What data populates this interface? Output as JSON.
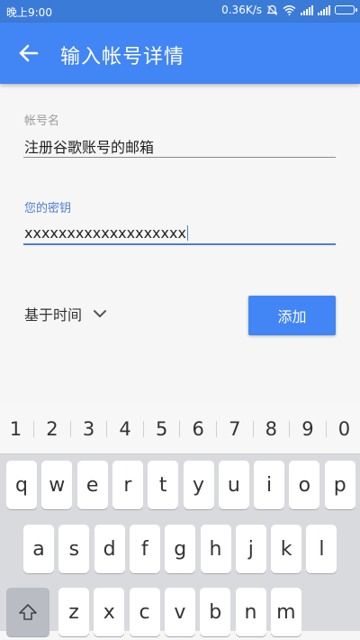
{
  "status_bar": {
    "time": "晚上9:00",
    "speed": "0.36K/s"
  },
  "app_bar": {
    "title": "输入帐号详情"
  },
  "form": {
    "account_label": "帐号名",
    "account_value": "注册谷歌账号的邮箱",
    "key_label": "您的密钥",
    "key_value": "xxxxxxxxxxxxxxxxxxx",
    "type_value": "基于时间",
    "add_button": "添加"
  },
  "keyboard": {
    "numbers": [
      "1",
      "2",
      "3",
      "4",
      "5",
      "6",
      "7",
      "8",
      "9",
      "0"
    ],
    "row1": [
      "q",
      "w",
      "e",
      "r",
      "t",
      "y",
      "u",
      "i",
      "o",
      "p"
    ],
    "row2": [
      "a",
      "s",
      "d",
      "f",
      "g",
      "h",
      "j",
      "k",
      "l"
    ],
    "row3": [
      "z",
      "x",
      "c",
      "v",
      "b",
      "n",
      "m"
    ]
  },
  "colors": {
    "status_bar": "#3b7bd8",
    "app_bar": "#4285f4",
    "accent": "#4a7fd4",
    "background": "#f6f6f6"
  }
}
